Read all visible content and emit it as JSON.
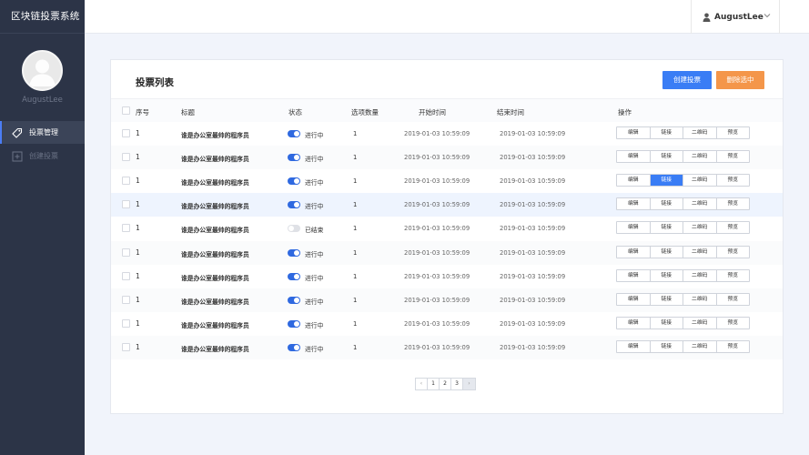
{
  "app": {
    "title": "区块链投票系统"
  },
  "sidebar": {
    "username": "AugustLee",
    "items": [
      {
        "label": "投票管理",
        "icon": "tag-icon",
        "active": true
      },
      {
        "label": "创建投票",
        "icon": "plus-square-icon",
        "active": false
      }
    ]
  },
  "header": {
    "username": "AugustLee",
    "user_icon": "user-icon",
    "dropdown_icon": "chevron-down-icon"
  },
  "main": {
    "title": "投票列表",
    "create_label": "创建投票",
    "delete_label": "删除选中",
    "accent_color": "#3a7df5",
    "delete_color": "#f4964a",
    "columns": [
      "序号",
      "标题",
      "状态",
      "选项数量",
      "开始时间",
      "结束时间",
      "操作"
    ],
    "rows": [
      {
        "seq": "1",
        "title": "谁是办公室最帅的程序员",
        "active": true,
        "status": "进行中",
        "options": "1",
        "start": "2019-01-03 10:59:09",
        "end": "2019-01-03 10:59:09"
      },
      {
        "seq": "1",
        "title": "谁是办公室最帅的程序员",
        "active": true,
        "status": "进行中",
        "options": "1",
        "start": "2019-01-03 10:59:09",
        "end": "2019-01-03 10:59:09"
      },
      {
        "seq": "1",
        "title": "谁是办公室最帅的程序员",
        "active": true,
        "status": "进行中",
        "options": "1",
        "start": "2019-01-03 10:59:09",
        "end": "2019-01-03 10:59:09"
      },
      {
        "seq": "1",
        "title": "谁是办公室最帅的程序员",
        "active": true,
        "status": "进行中",
        "options": "1",
        "start": "2019-01-03 10:59:09",
        "end": "2019-01-03 10:59:09"
      },
      {
        "seq": "1",
        "title": "谁是办公室最帅的程序员",
        "active": false,
        "status": "已结束",
        "options": "1",
        "start": "2019-01-03 10:59:09",
        "end": "2019-01-03 10:59:09"
      },
      {
        "seq": "1",
        "title": "谁是办公室最帅的程序员",
        "active": true,
        "status": "进行中",
        "options": "1",
        "start": "2019-01-03 10:59:09",
        "end": "2019-01-03 10:59:09"
      },
      {
        "seq": "1",
        "title": "谁是办公室最帅的程序员",
        "active": true,
        "status": "进行中",
        "options": "1",
        "start": "2019-01-03 10:59:09",
        "end": "2019-01-03 10:59:09"
      },
      {
        "seq": "1",
        "title": "谁是办公室最帅的程序员",
        "active": true,
        "status": "进行中",
        "options": "1",
        "start": "2019-01-03 10:59:09",
        "end": "2019-01-03 10:59:09"
      },
      {
        "seq": "1",
        "title": "谁是办公室最帅的程序员",
        "active": true,
        "status": "进行中",
        "options": "1",
        "start": "2019-01-03 10:59:09",
        "end": "2019-01-03 10:59:09"
      },
      {
        "seq": "1",
        "title": "谁是办公室最帅的程序员",
        "active": true,
        "status": "进行中",
        "options": "1",
        "start": "2019-01-03 10:59:09",
        "end": "2019-01-03 10:59:09"
      }
    ],
    "actions": [
      "编辑",
      "链接",
      "二维码",
      "预览"
    ],
    "highlighted_row": 3,
    "highlighted_action": {
      "row": 2,
      "action": 1
    }
  },
  "pagination": {
    "prev": "‹",
    "pages": [
      "1",
      "2",
      "3"
    ],
    "next": "›"
  }
}
